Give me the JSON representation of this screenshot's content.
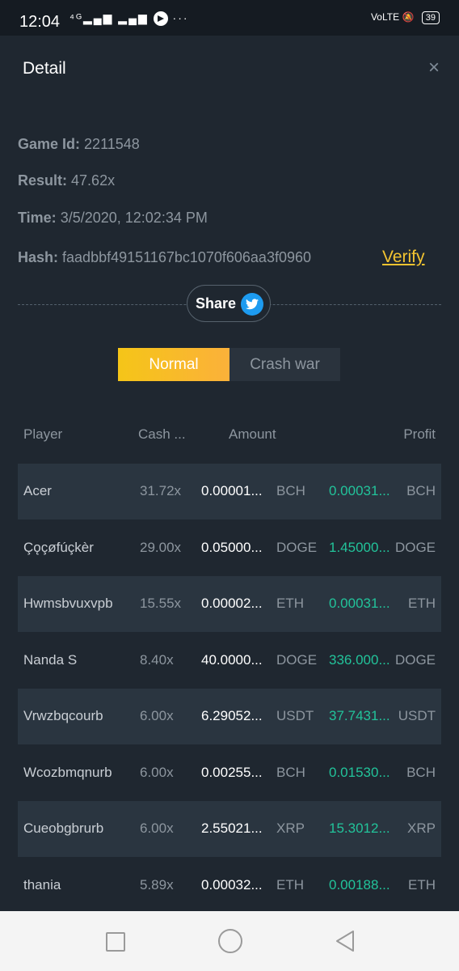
{
  "status": {
    "time": "12:04",
    "signal": "⁴ᴳ▂▄▆ ▂▄▆",
    "extra": "···",
    "volte": "VoLTE",
    "battery": "39"
  },
  "header": {
    "title": "Detail",
    "close": "×"
  },
  "info": {
    "game_id_label": "Game Id:",
    "game_id": "2211548",
    "result_label": "Result:",
    "result": "47.62x",
    "time_label": "Time:",
    "time": "3/5/2020, 12:02:34 PM",
    "hash_label": "Hash:",
    "hash": "faadbbf49151167bc1070f606aa3f0960",
    "verify": "Verify"
  },
  "share": {
    "label": "Share"
  },
  "tabs": [
    {
      "label": "Normal"
    },
    {
      "label": "Crash war"
    }
  ],
  "table": {
    "headers": {
      "player": "Player",
      "cash": "Cash ...",
      "amount": "Amount",
      "profit": "Profit"
    },
    "rows": [
      {
        "player": "Acer",
        "cash": "31.72x",
        "amount": "0.00001...",
        "currency": "BCH",
        "profit": "0.00031...",
        "profit_currency": "BCH"
      },
      {
        "player": "Çǫçøfúçkèr",
        "cash": "29.00x",
        "amount": "0.05000...",
        "currency": "DOGE",
        "profit": "1.45000...",
        "profit_currency": "DOGE"
      },
      {
        "player": "Hwmsbvuxvpb",
        "cash": "15.55x",
        "amount": "0.00002...",
        "currency": "ETH",
        "profit": "0.00031...",
        "profit_currency": "ETH"
      },
      {
        "player": "Nanda S",
        "cash": "8.40x",
        "amount": "40.0000...",
        "currency": "DOGE",
        "profit": "336.000...",
        "profit_currency": "DOGE"
      },
      {
        "player": "Vrwzbqcourb",
        "cash": "6.00x",
        "amount": "6.29052...",
        "currency": "USDT",
        "profit": "37.7431...",
        "profit_currency": "USDT"
      },
      {
        "player": "Wcozbmqnurb",
        "cash": "6.00x",
        "amount": "0.00255...",
        "currency": "BCH",
        "profit": "0.01530...",
        "profit_currency": "BCH"
      },
      {
        "player": "Cueobgbrurb",
        "cash": "6.00x",
        "amount": "2.55021...",
        "currency": "XRP",
        "profit": "15.3012...",
        "profit_currency": "XRP"
      },
      {
        "player": "thania",
        "cash": "5.89x",
        "amount": "0.00032...",
        "currency": "ETH",
        "profit": "0.00188...",
        "profit_currency": "ETH"
      }
    ]
  },
  "colors": {
    "accent": "#f5c518",
    "profit": "#22c39a",
    "background": "#1f2730",
    "row_shade": "#2a3540"
  }
}
